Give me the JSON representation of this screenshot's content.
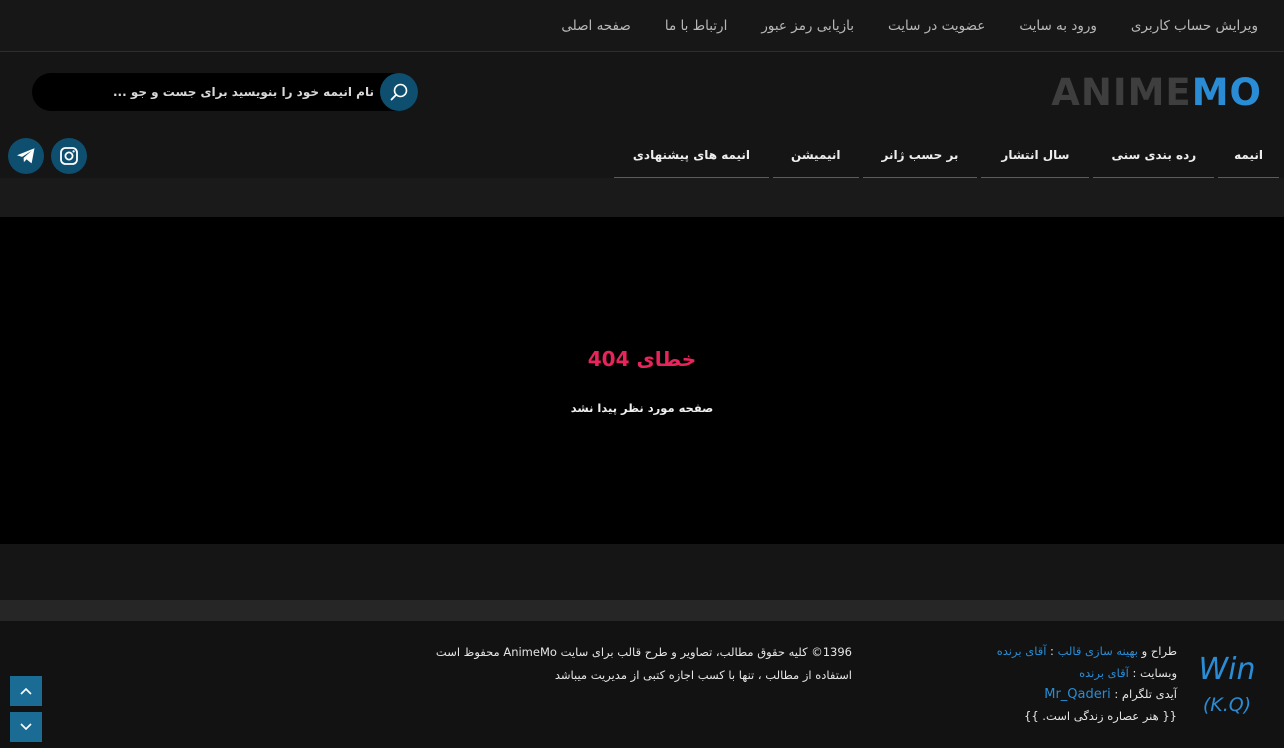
{
  "topnav": [
    {
      "label": "صفحه اصلی"
    },
    {
      "label": "ارتباط با ما"
    },
    {
      "label": "بازیابی رمز عبور"
    },
    {
      "label": "عضویت در سایت"
    },
    {
      "label": "ورود به سایت"
    },
    {
      "label": "ویرایش حساب کاربری"
    }
  ],
  "logo": {
    "part1": "ANIME",
    "part2": "MO"
  },
  "search": {
    "placeholder": "نام انیمه خود را بنویسید برای جست و جو ..."
  },
  "mainnav": [
    {
      "label": "انیمه"
    },
    {
      "label": "رده بندی سنی"
    },
    {
      "label": "سال انتشار"
    },
    {
      "label": "بر حسب ژانر"
    },
    {
      "label": "انیمیشن"
    },
    {
      "label": "انیمه های پیشنهادی"
    }
  ],
  "social": [
    "instagram-icon",
    "telegram-icon"
  ],
  "error": {
    "title": "خطای 404",
    "message": "صفحه مورد نظر پیدا نشد"
  },
  "footer": {
    "credits": {
      "line1_prefix": "طراح و ",
      "line1_link": "بهینه سازی قالب",
      "line1_sep": " : ",
      "line1_name": "آقای برنده",
      "line2_prefix": "وبسایت : ",
      "line2_link": "آقای برنده",
      "line3_prefix": "آیدی تلگرام : ",
      "line3_link": "Mr_Qaderi",
      "line4": "{{ هنر عصاره زندگی است. }}"
    },
    "logo_text_top": "Win",
    "logo_text_bottom": "(K.Q)",
    "copyright_line1": "1396© کلیه حقوق مطالب، تصاویر و طرح قالب برای سایت AnimeMo محفوظ است",
    "copyright_line2": "استفاده از مطالب ، تنها با کسب اجازه کتبی از مدیریت میباشد"
  },
  "colors": {
    "accent": "#2a8cd4",
    "error": "#e8245a",
    "button": "#0e4f70"
  }
}
